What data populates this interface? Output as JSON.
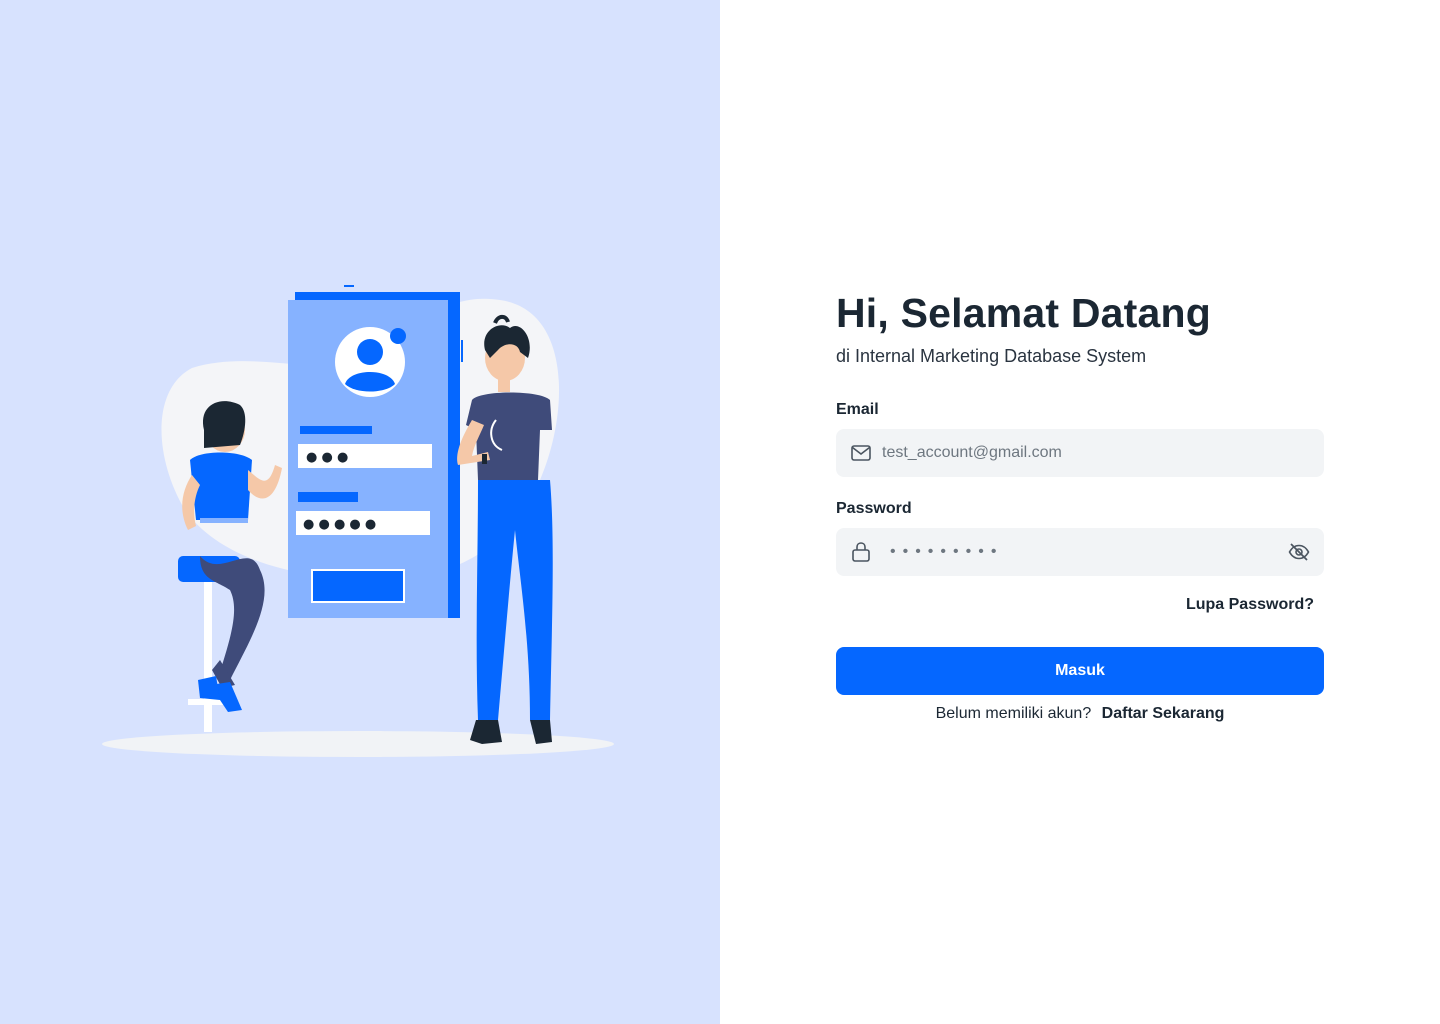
{
  "colors": {
    "left_panel_bg": "#d7e2fe",
    "primary": "#0567ff",
    "input_bg": "#f2f4f6",
    "text_dark": "#1b2733"
  },
  "illustration": {
    "icon": "login-illustration",
    "form_mock_dots_row1": "● ● ●",
    "form_mock_dots_row2": "● ● ● ● ●"
  },
  "header": {
    "title": "Hi, Selamat Datang",
    "subtitle": "di Internal Marketing Database System"
  },
  "form": {
    "email_label": "Email",
    "email_value": "test_account@gmail.com",
    "email_icon": "mail-icon",
    "password_label": "Password",
    "password_mask": "•••••••••",
    "password_icon": "lock-icon",
    "password_toggle_icon": "eye-off-icon",
    "forgot_label": "Lupa Password?",
    "submit_label": "Masuk"
  },
  "register": {
    "prompt": "Belum memiliki akun?",
    "link_label": "Daftar Sekarang"
  }
}
